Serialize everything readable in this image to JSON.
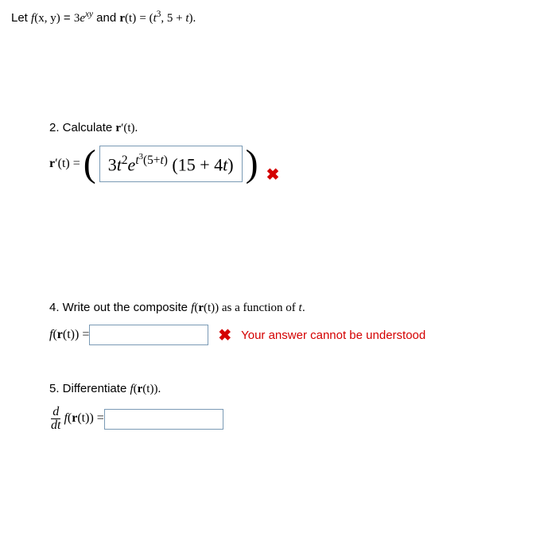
{
  "problem": {
    "let_prefix": "Let  ",
    "f_lhs": "f",
    "f_args": "(x, y)",
    "eq": " = ",
    "f_rhs_coeff": "3",
    "f_rhs_base": "e",
    "f_rhs_exp": "xy",
    "and": "  and  ",
    "r_lhs": "r",
    "r_args": "(t)",
    "r_rhs_l": " = (",
    "r_rhs_t": "t",
    "r_rhs_pow": "3",
    "r_rhs_rest": ", 5 + ",
    "r_rhs_t2": "t",
    "r_rhs_close": ")."
  },
  "q2": {
    "text_a": "2. Calculate  ",
    "text_b": "r",
    "text_c": "′(t).",
    "lhs_a": "r",
    "lhs_b": "′(t) = ",
    "ans": {
      "a": "3",
      "b": "t",
      "c": "2",
      "d": "e",
      "e": "t",
      "f": "3",
      "g": "(5+",
      "h": "t",
      "i": ")",
      "j": "(15 + 4",
      "k": "t",
      "l": ")"
    }
  },
  "q4": {
    "text_a": "4. Write out the composite  ",
    "text_b": "f",
    "text_c": "(",
    "text_d": "r",
    "text_e": "(t))  as a function of ",
    "text_f": "t",
    "text_g": ".",
    "lhs_a": "f",
    "lhs_b": "(",
    "lhs_c": "r",
    "lhs_d": "(t)) = ",
    "value": "",
    "error": "Your answer cannot be understood"
  },
  "q5": {
    "text_a": "5. Differentiate  ",
    "text_b": "f",
    "text_c": "(",
    "text_d": "r",
    "text_e": "(t)).",
    "frac_num": "d",
    "frac_den": "dt",
    "lhs_a": "f",
    "lhs_b": "(",
    "lhs_c": "r",
    "lhs_d": "(t)) = ",
    "value": ""
  },
  "icons": {
    "wrong": "✖"
  }
}
